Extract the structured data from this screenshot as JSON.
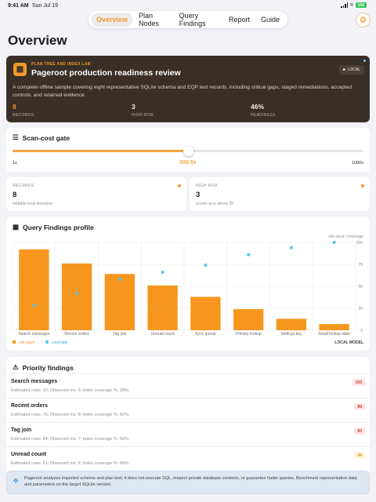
{
  "status": {
    "time": "9:41 AM",
    "date": "Sun Jul 19",
    "battery": "100"
  },
  "nav": {
    "tabs": [
      "Overview",
      "Plan Nodes",
      "Query Findings",
      "Report",
      "Guide"
    ],
    "active": 0
  },
  "page_title": "Overview",
  "hero": {
    "eyebrow": "PLAN TREE AND INDEX LAB",
    "title": "Pageroot production readiness review",
    "badge": "LOCAL",
    "description": "A complete offline sample covering eight representative SQLite schema and EQP text records, including critical gaps, staged remediations, accepted controls, and retained evidence.",
    "stats": [
      {
        "value": "8",
        "label": "RECORDS"
      },
      {
        "value": "3",
        "label": "HIGH RISK"
      },
      {
        "value": "46%",
        "label": "READINESS"
      }
    ]
  },
  "gate": {
    "title": "Scan-cost gate",
    "min_label": "1x",
    "max_label": "1000x",
    "value_label": "500.5x",
    "value_fraction": 0.5
  },
  "cards": [
    {
      "label": "RECORDS",
      "value": "8",
      "note": "editable local inventory"
    },
    {
      "label": "HIGH RISK",
      "value": "3",
      "note": "scores at or above 55"
    }
  ],
  "chart": {
    "title": "Query Findings profile",
    "axis_caption": "risk input / coverage",
    "legend": [
      "risk input",
      "coverage"
    ],
    "badge": "LOCAL MODEL",
    "colors": {
      "risk": "#f7961e",
      "coverage": "#55c3ec"
    }
  },
  "chart_data": {
    "type": "bar",
    "categories": [
      "Search messages",
      "Recent orders",
      "Tag join",
      "Unread count",
      "Sync queue",
      "Primary lookup",
      "Settings key",
      "Small lookup table"
    ],
    "series": [
      {
        "name": "risk input",
        "values": [
          92,
          76,
          64,
          51,
          38,
          24,
          13,
          7
        ]
      },
      {
        "name": "coverage",
        "values": [
          28,
          42,
          58,
          66,
          74,
          86,
          94,
          100
        ]
      }
    ],
    "yticks": [
      0,
      25,
      50,
      75,
      100
    ],
    "ylim": [
      0,
      100
    ]
  },
  "priority": {
    "title": "Priority findings",
    "items": [
      {
        "name": "Search messages",
        "meta": "Estimated rows: 92; Observed ms: 9; Index coverage %: 28%.",
        "score": "100",
        "color": "#d63a3a",
        "bg": "#fde4e4"
      },
      {
        "name": "Recent orders",
        "meta": "Estimated rows: 76; Observed ms: 8; Index coverage %: 42%.",
        "score": "88",
        "color": "#d63a3a",
        "bg": "#fde4e4"
      },
      {
        "name": "Tag join",
        "meta": "Estimated rows: 64; Observed ms: 7; Index coverage %: 58%.",
        "score": "60",
        "color": "#d63a3a",
        "bg": "#fde4e4"
      },
      {
        "name": "Unread count",
        "meta": "Estimated rows: 51; Observed ms: 6; Index coverage %: 66%.",
        "score": "54",
        "color": "#c89a12",
        "bg": "#fdf4d8"
      }
    ]
  },
  "footer_note": "Pageroot analyzes imported schema and plan text; it does not execute SQL, inspect private database contents, or guarantee faster queries. Benchmark representative data and parameters on the target SQLite version."
}
